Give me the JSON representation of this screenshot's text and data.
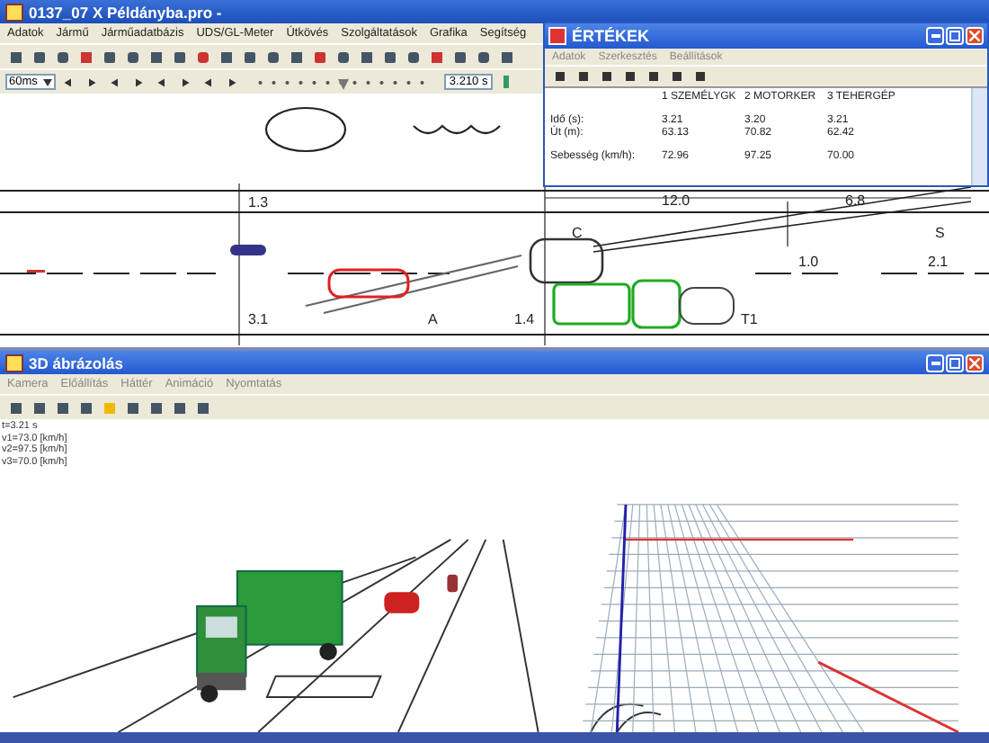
{
  "main_window": {
    "title": "0137_07 X Példányba.pro -",
    "menu": [
      "Adatok",
      "Jármű",
      "Járműadatbázis",
      "UDS/GL-Meter",
      "Útkövés",
      "Szolgáltatások",
      "Grafika",
      "Segítség"
    ],
    "zoom_select": "60ms",
    "time_slider": {
      "level": 0.5
    },
    "time_field": "3.210 s"
  },
  "diagram": {
    "labels": [
      "1.3",
      "12.0",
      "6.8",
      "C",
      "S",
      "1.0",
      "2.1",
      "3.1",
      "A",
      "1.4",
      "T1"
    ]
  },
  "values_window": {
    "title": "ÉRTÉKEK",
    "menu": [
      "Adatok",
      "Szerkesztés",
      "Beállítások"
    ],
    "columns": [
      "1 SZEMÉLYGK",
      "2 MOTORKER",
      "3 TEHERGÉP"
    ],
    "rows": [
      {
        "label": "Idő (s):",
        "values": [
          "3.21",
          "3.20",
          "3.21"
        ]
      },
      {
        "label": "Út (m):",
        "values": [
          "63.13",
          "70.82",
          "62.42"
        ]
      },
      {
        "label": "Sebesség (km/h):",
        "values": [
          "72.96",
          "97.25",
          "70.00"
        ]
      }
    ]
  },
  "view3d_window": {
    "title": "3D ábrázolás",
    "menu": [
      "Kamera",
      "Előállítás",
      "Háttér",
      "Animáció",
      "Nyomtatás"
    ],
    "readouts": [
      "t=3.21 s",
      "v1=73.0 [km/h]",
      "v2=97.5 [km/h]",
      "v3=70.0 [km/h]"
    ]
  }
}
